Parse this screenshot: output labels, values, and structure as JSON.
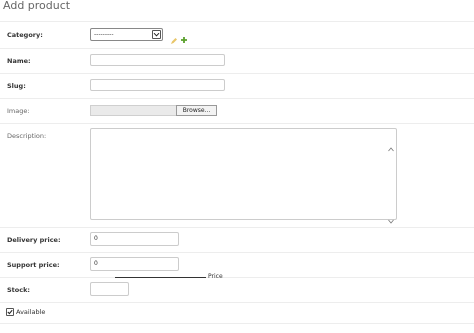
{
  "page": {
    "title": "Add product"
  },
  "form": {
    "category": {
      "label": "Category:",
      "selected": "---------"
    },
    "name": {
      "label": "Name:",
      "value": ""
    },
    "slug": {
      "label": "Slug:",
      "value": ""
    },
    "image": {
      "label": "Image:",
      "browse_label": "Browse..."
    },
    "description": {
      "label": "Description:",
      "value": ""
    },
    "delivery_price": {
      "label": "Delivery price:",
      "value": "0"
    },
    "support_price": {
      "label": "Support price:",
      "value": "0"
    },
    "price_caption": "Price",
    "stock": {
      "label": "Stock:",
      "value": ""
    },
    "available": {
      "label": "Available",
      "checked": true
    }
  },
  "colors": {
    "add_icon": "#5aa02c",
    "edit_icon": "#e8c66a"
  },
  "icons": [
    "chevron-down-icon",
    "pencil-icon",
    "plus-icon",
    "scroll-up-icon",
    "scroll-down-icon",
    "checkmark-icon"
  ]
}
